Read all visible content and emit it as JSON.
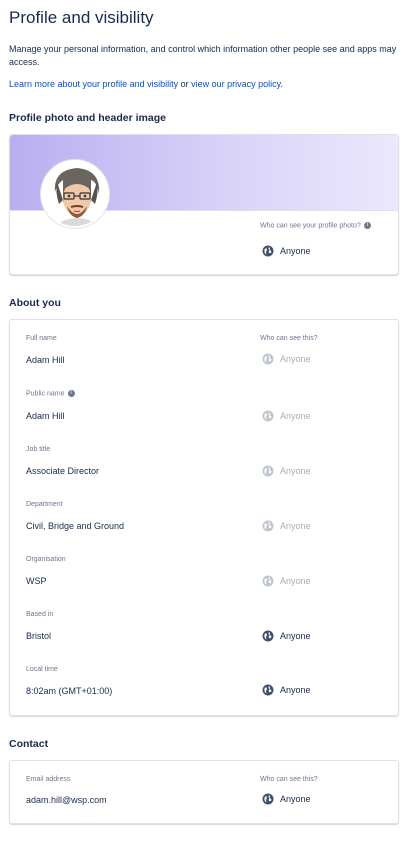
{
  "page": {
    "title": "Profile and visibility",
    "intro": "Manage your personal information, and control which information other people see and apps may access.",
    "learn_more_link": "Learn more about your profile and visibility",
    "or_text": " or ",
    "privacy_link": "view our privacy policy",
    "period": "."
  },
  "photo_section": {
    "heading": "Profile photo and header image",
    "visibility_label": "Who can see your profile photo?",
    "visibility_value": "Anyone"
  },
  "about_section": {
    "heading": "About you",
    "visibility_header": "Who can see this?",
    "fields": [
      {
        "label": "Full name",
        "value": "Adam Hill",
        "visibility": "Anyone",
        "editable_visibility": false
      },
      {
        "label": "Public name",
        "value": "Adam Hill",
        "visibility": "Anyone",
        "editable_visibility": false
      },
      {
        "label": "Job title",
        "value": "Associate Director",
        "visibility": "Anyone",
        "editable_visibility": false
      },
      {
        "label": "Department",
        "value": "Civil, Bridge and Ground",
        "visibility": "Anyone",
        "editable_visibility": false
      },
      {
        "label": "Organisation",
        "value": "WSP",
        "visibility": "Anyone",
        "editable_visibility": false
      },
      {
        "label": "Based in",
        "value": "Bristol",
        "visibility": "Anyone",
        "editable_visibility": true
      },
      {
        "label": "Local time",
        "value": "8:02am (GMT+01:00)",
        "visibility": "Anyone",
        "editable_visibility": true
      }
    ]
  },
  "contact_section": {
    "heading": "Contact",
    "visibility_header": "Who can see this?",
    "email_label": "Email address",
    "email_value": "adam.hill@wsp.com",
    "email_visibility": "Anyone"
  },
  "icons": {
    "globe": "globe-icon",
    "info": "info-icon"
  },
  "colors": {
    "link": "#0052cc",
    "banner_start": "#b8aef0",
    "banner_end": "#ebe8fd",
    "muted_text": "#6b778c",
    "disabled_text": "#a5adba"
  }
}
